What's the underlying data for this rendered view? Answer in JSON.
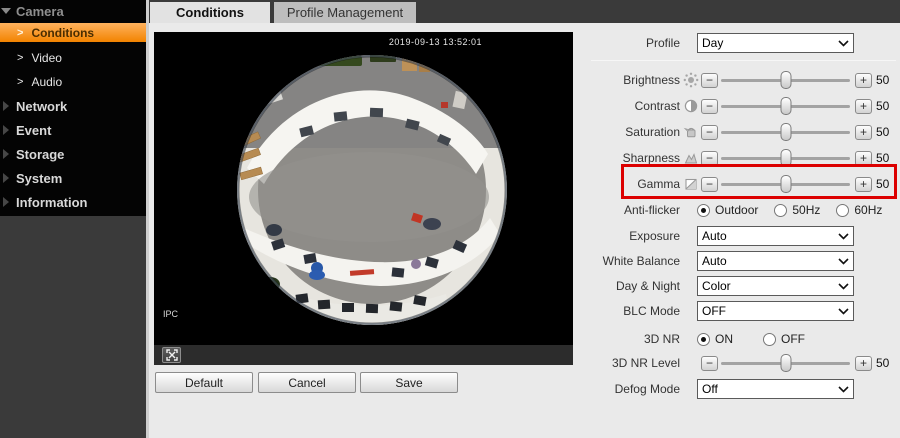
{
  "sidebar": {
    "chevron": ">",
    "camera": {
      "label": "Camera",
      "items": [
        {
          "label": "Conditions"
        },
        {
          "label": "Video"
        },
        {
          "label": "Audio"
        }
      ]
    },
    "sections": [
      {
        "label": "Network"
      },
      {
        "label": "Event"
      },
      {
        "label": "Storage"
      },
      {
        "label": "System"
      },
      {
        "label": "Information"
      }
    ]
  },
  "tabs": [
    {
      "label": "Conditions"
    },
    {
      "label": "Profile Management"
    }
  ],
  "video": {
    "timestamp": "2019-09-13 13:52:01",
    "watermark": "IPC"
  },
  "action_buttons": [
    {
      "label": "Default"
    },
    {
      "label": "Cancel"
    },
    {
      "label": "Save"
    }
  ],
  "panel": {
    "stepper": {
      "minus_label": "−",
      "plus_label": "+"
    },
    "profile": {
      "label": "Profile",
      "value": "Day"
    },
    "sliders": [
      {
        "label": "Brightness",
        "icon": "brightness-icon",
        "value": "50"
      },
      {
        "label": "Contrast",
        "icon": "contrast-icon",
        "value": "50"
      },
      {
        "label": "Saturation",
        "icon": "saturation-icon",
        "value": "50"
      },
      {
        "label": "Sharpness",
        "icon": "sharpness-icon",
        "value": "50"
      },
      {
        "label": "Gamma",
        "icon": "gamma-icon",
        "value": "50",
        "highlighted": true
      }
    ],
    "anti_flicker": {
      "label": "Anti-flicker",
      "options": [
        {
          "label": "Outdoor",
          "selected": true
        },
        {
          "label": "50Hz",
          "selected": false
        },
        {
          "label": "60Hz",
          "selected": false
        }
      ]
    },
    "selects": [
      {
        "label": "Exposure",
        "value": "Auto"
      },
      {
        "label": "White Balance",
        "value": "Auto"
      },
      {
        "label": "Day & Night",
        "value": "Color"
      },
      {
        "label": "BLC Mode",
        "value": "OFF"
      }
    ],
    "nr": {
      "label": "3D NR",
      "options": [
        {
          "label": "ON",
          "selected": true
        },
        {
          "label": "OFF",
          "selected": false
        }
      ]
    },
    "nr_level": {
      "label": "3D NR Level",
      "value": "50"
    },
    "defog": {
      "label": "Defog Mode",
      "value": "Off"
    }
  },
  "colors": {
    "accent_orange": "#f28300",
    "highlight_red": "#dc0000",
    "sidebar_bg": "#040404"
  }
}
